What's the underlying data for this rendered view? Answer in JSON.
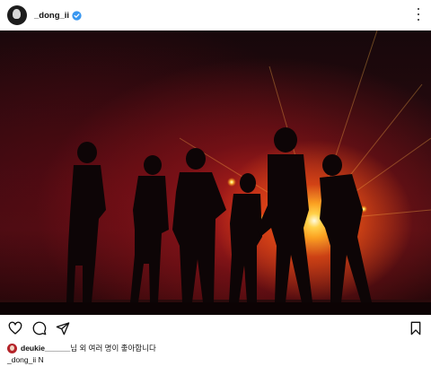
{
  "post": {
    "username": "_dong_ii",
    "verified": true,
    "photo_description_icon": "concert-silhouette-photo"
  },
  "likes": {
    "username": "deukie______",
    "text": "님 외 여러 명이 좋아합니다"
  },
  "caption": {
    "username": "_dong_ii",
    "text": "N"
  },
  "icons": [
    "heart-icon",
    "comment-icon",
    "share-icon",
    "bookmark-icon",
    "more-icon",
    "verified-icon"
  ],
  "colors": {
    "verified": "#3897f0",
    "text": "#111111"
  }
}
